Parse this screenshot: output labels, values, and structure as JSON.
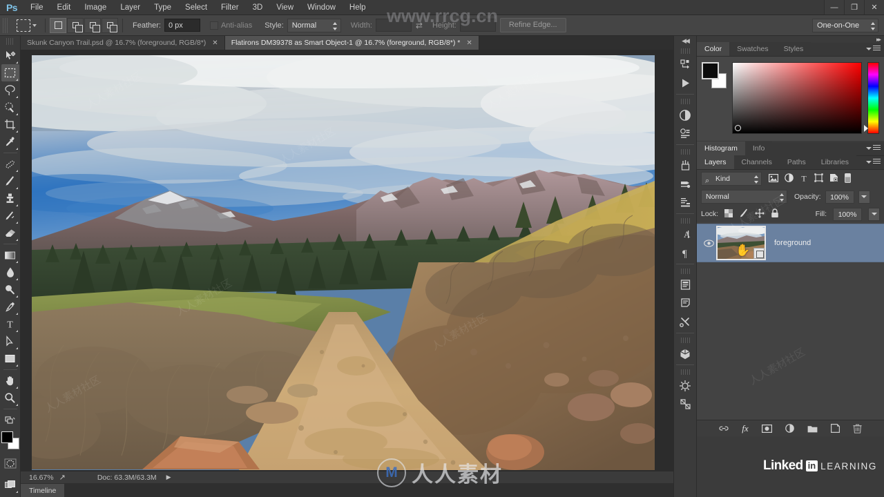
{
  "app": {
    "name": "Ps",
    "logo_label": "Ps"
  },
  "menubar": {
    "items": [
      {
        "label": "File"
      },
      {
        "label": "Edit"
      },
      {
        "label": "Image"
      },
      {
        "label": "Layer"
      },
      {
        "label": "Type"
      },
      {
        "label": "Select"
      },
      {
        "label": "Filter"
      },
      {
        "label": "3D"
      },
      {
        "label": "View"
      },
      {
        "label": "Window"
      },
      {
        "label": "Help"
      }
    ],
    "window_controls": {
      "minimize": "—",
      "restore": "❐",
      "close": "✕"
    }
  },
  "options_bar": {
    "tool": "Rectangular Marquee Tool",
    "feather_label": "Feather:",
    "feather_value": "0 px",
    "antialias_label": "Anti-alias",
    "style_label": "Style:",
    "style_value": "Normal",
    "width_label": "Width:",
    "width_value": "",
    "height_label": "Height:",
    "height_value": "",
    "refine_edge_label": "Refine Edge...",
    "workspace_value": "One-on-One"
  },
  "toolbar": {
    "tools": [
      {
        "name": "move-tool",
        "glyph": "✥"
      },
      {
        "name": "rectangular-marquee-tool",
        "glyph": "▭",
        "active": true
      },
      {
        "name": "lasso-tool",
        "glyph": "◯"
      },
      {
        "name": "quick-selection-tool",
        "glyph": "✧"
      },
      {
        "name": "crop-tool",
        "glyph": "⌗"
      },
      {
        "name": "eyedropper-tool",
        "glyph": "⟋"
      },
      {
        "name": "spot-healing-brush-tool",
        "glyph": "✑"
      },
      {
        "name": "brush-tool",
        "glyph": "✎"
      },
      {
        "name": "clone-stamp-tool",
        "glyph": "⎙"
      },
      {
        "name": "history-brush-tool",
        "glyph": "↺"
      },
      {
        "name": "eraser-tool",
        "glyph": "▰"
      },
      {
        "name": "gradient-tool",
        "glyph": "▤"
      },
      {
        "name": "blur-tool",
        "glyph": "💧"
      },
      {
        "name": "dodge-tool",
        "glyph": "◕"
      },
      {
        "name": "pen-tool",
        "glyph": "✒"
      },
      {
        "name": "horizontal-type-tool",
        "glyph": "T"
      },
      {
        "name": "path-selection-tool",
        "glyph": "▷"
      },
      {
        "name": "rectangle-tool",
        "glyph": "▢"
      },
      {
        "name": "hand-tool",
        "glyph": "✋"
      },
      {
        "name": "zoom-tool",
        "glyph": "🔍"
      }
    ],
    "foreground_color": "#000000",
    "background_color": "#ffffff",
    "quick_mask_name": "quick-mask-mode",
    "screen_mode_name": "screen-mode"
  },
  "document_tabs": [
    {
      "title": "Skunk Canyon Trail.psd @ 16.7% (foreground, RGB/8*)",
      "active": false,
      "close": "✕"
    },
    {
      "title": "Flatirons DM39378 as Smart Object-1 @ 16.7% (foreground, RGB/8*) *",
      "active": true,
      "close": "✕"
    }
  ],
  "canvas": {
    "image_description": "Flatirons mountain trail landscape — dirt path through grassland with pine trees and rocky ridgeline under cloudy blue sky"
  },
  "status_bar": {
    "zoom": "16.67%",
    "share_icon": "↗",
    "doc_info": "Doc: 63.3M/63.3M",
    "expand_arrow": "▶"
  },
  "timeline": {
    "tab_label": "Timeline"
  },
  "icon_dock": {
    "collapse_label": "◀◀",
    "groups": [
      [
        "history-panel-icon",
        "actions-play-icon"
      ],
      [
        "adjustments-panel-icon",
        "properties-panel-icon"
      ],
      [
        "brush-panel-icon",
        "brush-presets-icon",
        "clone-source-icon"
      ],
      [
        "character-panel-icon",
        "paragraph-panel-icon"
      ],
      [
        "character-styles-icon",
        "paragraph-styles-icon",
        "tool-presets-icon"
      ],
      [
        "3d-panel-icon"
      ],
      [
        "timeline-panel-icon",
        "measurement-log-icon"
      ]
    ]
  },
  "color_panel": {
    "tabs": [
      {
        "label": "Color",
        "active": true
      },
      {
        "label": "Swatches",
        "active": false
      },
      {
        "label": "Styles",
        "active": false
      }
    ],
    "foreground": "#000000",
    "background": "#ffffff",
    "picker_hue": "#ff0000"
  },
  "histogram_panel": {
    "tabs": [
      {
        "label": "Histogram",
        "active": true
      },
      {
        "label": "Info",
        "active": false
      }
    ]
  },
  "layers_panel": {
    "tabs": [
      {
        "label": "Layers",
        "active": true
      },
      {
        "label": "Channels",
        "active": false
      },
      {
        "label": "Paths",
        "active": false
      },
      {
        "label": "Libraries",
        "active": false
      }
    ],
    "filter_label": "Kind",
    "filter_icons": [
      "pixel-layers-filter-icon",
      "adjustment-layers-filter-icon",
      "type-layers-filter-icon",
      "shape-layers-filter-icon",
      "smart-object-filter-icon",
      "filter-toggle-icon"
    ],
    "blend_mode": "Normal",
    "opacity_label": "Opacity:",
    "opacity_value": "100%",
    "lock_label": "Lock:",
    "lock_icons": [
      "lock-transparent-pixels-icon",
      "lock-image-pixels-icon",
      "lock-position-icon",
      "lock-all-icon"
    ],
    "fill_label": "Fill:",
    "fill_value": "100%",
    "layers": [
      {
        "name": "foreground",
        "visible": true,
        "selected": true,
        "type": "smart-object"
      }
    ],
    "bottom_icons": [
      "link-layers-icon",
      "layer-style-fx-icon",
      "add-layer-mask-icon",
      "new-adjustment-layer-icon",
      "new-group-icon",
      "new-layer-icon",
      "delete-layer-icon"
    ],
    "fx_label": "fx"
  },
  "watermarks": {
    "top_url": "www.rrcg.cn",
    "bottom_text": "人人素材",
    "bottom_logo": "M",
    "diagonal_text": "人人素材社区",
    "linkedin": {
      "word": "Linked",
      "in": "in",
      "learning": "LEARNING"
    }
  }
}
